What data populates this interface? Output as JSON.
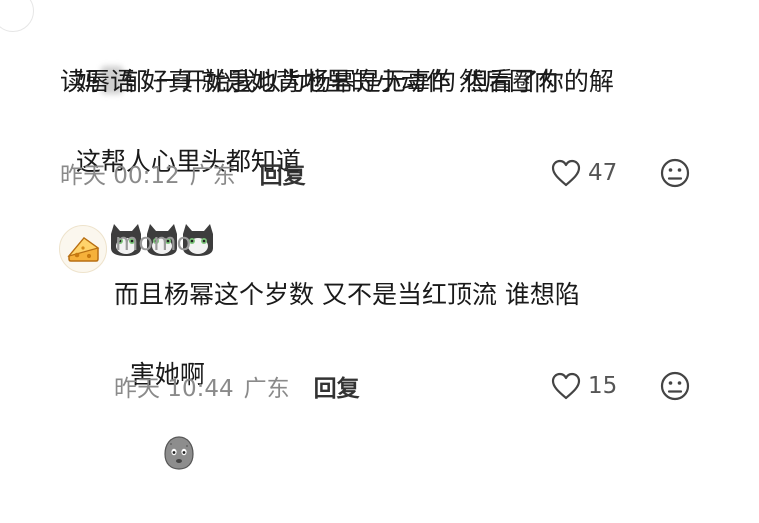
{
  "comment1": {
    "line1_pre": "妈",
    "line1_post": "郁 一开始我以为杨幂是无辜的 但看了你的解",
    "line2": "读唇语 好真 就是她背地里的小动作 然后圈内",
    "line3": "这帮人心里头都知道",
    "emoji": "cat-emoji",
    "time": "昨天 00:12",
    "location": "广东",
    "reply_label": "回复",
    "likes": "47"
  },
  "reply1": {
    "username": "momo",
    "line1": "而且杨幂这个岁数 又不是当红顶流 谁想陷",
    "line2": "害她啊",
    "emoji": "potato-emoji",
    "time": "昨天 10:44",
    "location": "广东",
    "reply_label": "回复",
    "likes": "15"
  },
  "colors": {
    "text": "#1a1a1a",
    "meta": "#8a8a8a",
    "username": "#9a9a9a"
  }
}
